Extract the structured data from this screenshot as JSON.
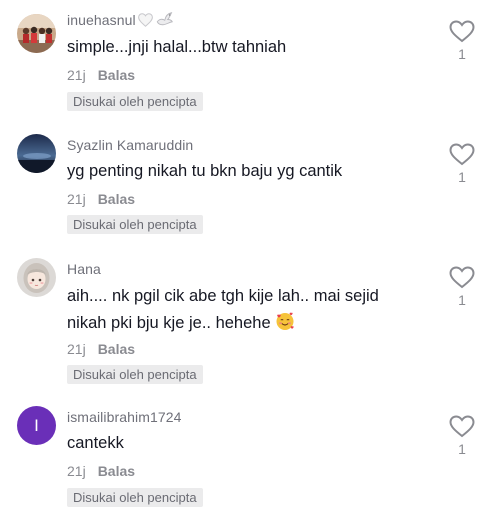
{
  "comments": [
    {
      "username": "inuehasnul",
      "name_icons": [
        "white-heart-icon",
        "dove-icon"
      ],
      "text": "simple...jnji halal...btw tahniah",
      "time": "21j",
      "reply_label": "Balas",
      "badge": "Disukai oleh pencipta",
      "likes": "1",
      "avatar": "group-photo"
    },
    {
      "username": "Syazlin Kamaruddin",
      "text": "yg penting nikah tu bkn baju yg cantik",
      "time": "21j",
      "reply_label": "Balas",
      "badge": "Disukai oleh pencipta",
      "likes": "1",
      "avatar": "sunset-photo"
    },
    {
      "username": "Hana",
      "text_line1": "aih.... nk pgil cik abe tgh kije lah.. mai sejid",
      "text_line2": "nikah pki bju kje je.. hehehe",
      "text_emoji": "smiling-face-with-hearts-emoji",
      "time": "21j",
      "reply_label": "Balas",
      "badge": "Disukai oleh pencipta",
      "likes": "1",
      "avatar": "cartoon-girl"
    },
    {
      "username": "ismailibrahim1724",
      "avatar_letter": "I",
      "text": "cantekk",
      "time": "21j",
      "reply_label": "Balas",
      "badge": "Disukai oleh pencipta",
      "likes": "1",
      "avatar": "letter-avatar"
    }
  ],
  "colors": {
    "text": "#161823",
    "username": "#6f7079",
    "meta": "#8a8b91",
    "badge_bg": "#ebebec",
    "letter_avatar_bg": "#6a2fb8"
  }
}
